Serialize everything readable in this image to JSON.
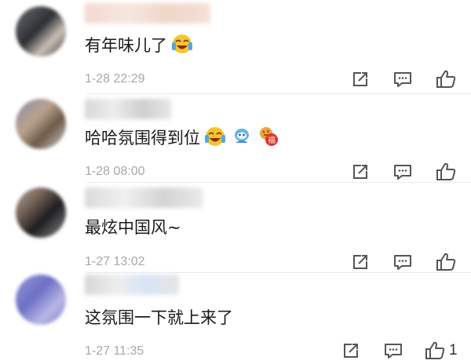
{
  "comments": [
    {
      "text": "有年味儿了",
      "time": "1-28 22:29",
      "emojis": [
        "laughing-tears-emoji"
      ],
      "likes": ""
    },
    {
      "text": "哈哈氛围得到位",
      "time": "1-28 08:00",
      "emojis": [
        "laughing-tears-emoji",
        "blue-mascot-emoji",
        "tiger-fu-emoji"
      ],
      "likes": ""
    },
    {
      "text": "最炫中国风~",
      "time": "1-27 13:02",
      "emojis": [],
      "likes": ""
    },
    {
      "text": "这氛围一下就上来了",
      "time": "1-27 11:35",
      "emojis": [],
      "likes": "1"
    }
  ],
  "icons": {
    "share": "share-icon",
    "reply": "reply-icon",
    "like": "thumbs-up-icon"
  },
  "colors": {
    "text": "#1a1a1a",
    "meta": "#a8a8a8",
    "icon": "#555555"
  }
}
